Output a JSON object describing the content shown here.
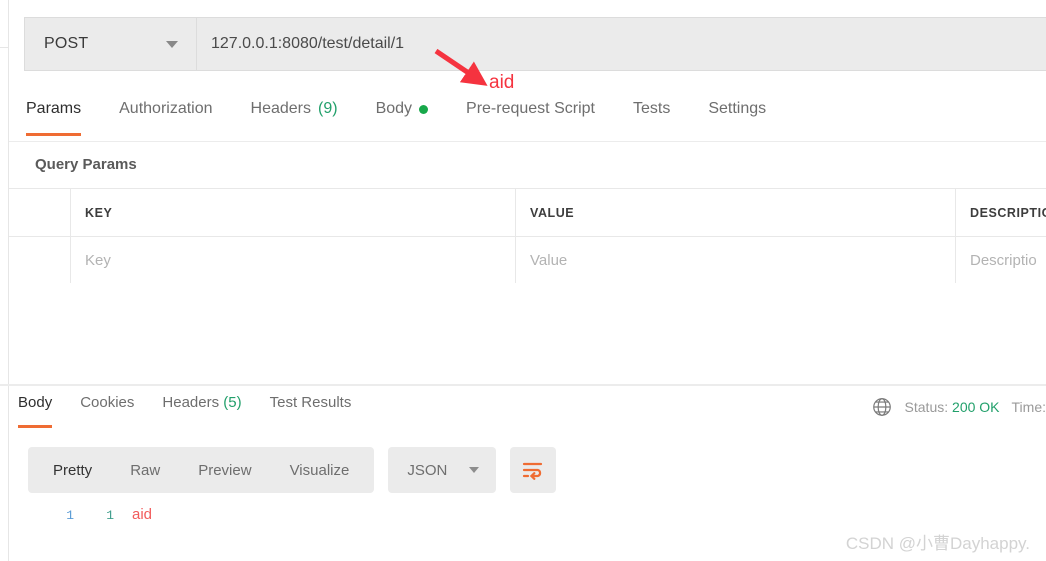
{
  "request": {
    "method": "POST",
    "url": "127.0.0.1:8080/test/detail/1",
    "tabs": [
      {
        "label": "Params",
        "badge": "",
        "dot": false
      },
      {
        "label": "Authorization",
        "badge": "",
        "dot": false
      },
      {
        "label": "Headers",
        "badge": "(9)",
        "dot": false
      },
      {
        "label": "Body",
        "badge": "",
        "dot": true
      },
      {
        "label": "Pre-request Script",
        "badge": "",
        "dot": false
      },
      {
        "label": "Tests",
        "badge": "",
        "dot": false
      },
      {
        "label": "Settings",
        "badge": "",
        "dot": false
      }
    ],
    "query_params": {
      "section_title": "Query Params",
      "headers": {
        "key": "KEY",
        "value": "VALUE",
        "description": "DESCRIPTIO"
      },
      "placeholder_row": {
        "key": "Key",
        "value": "Value",
        "description": "Descriptio"
      }
    }
  },
  "response": {
    "tabs": [
      {
        "label": "Body",
        "badge": ""
      },
      {
        "label": "Cookies",
        "badge": ""
      },
      {
        "label": "Headers",
        "badge": "(5)"
      },
      {
        "label": "Test Results",
        "badge": ""
      }
    ],
    "status": {
      "status_label": "Status:",
      "status_value": "200 OK",
      "time_label": "Time:",
      "time_value": ""
    },
    "toolbar": {
      "view_modes": [
        "Pretty",
        "Raw",
        "Preview",
        "Visualize"
      ],
      "active_view_mode": "Pretty",
      "format": "JSON"
    },
    "body_lines": [
      {
        "gutter": "1",
        "inner": "1",
        "text": "aid"
      }
    ]
  },
  "annotation": {
    "label": "aid"
  },
  "watermark": "CSDN @小曹Dayhappy.",
  "colors": {
    "accent_orange": "#ef6c33",
    "status_green": "#22a06b",
    "annotation_red": "#f5333f",
    "body_value_red": "#f15b5b"
  }
}
